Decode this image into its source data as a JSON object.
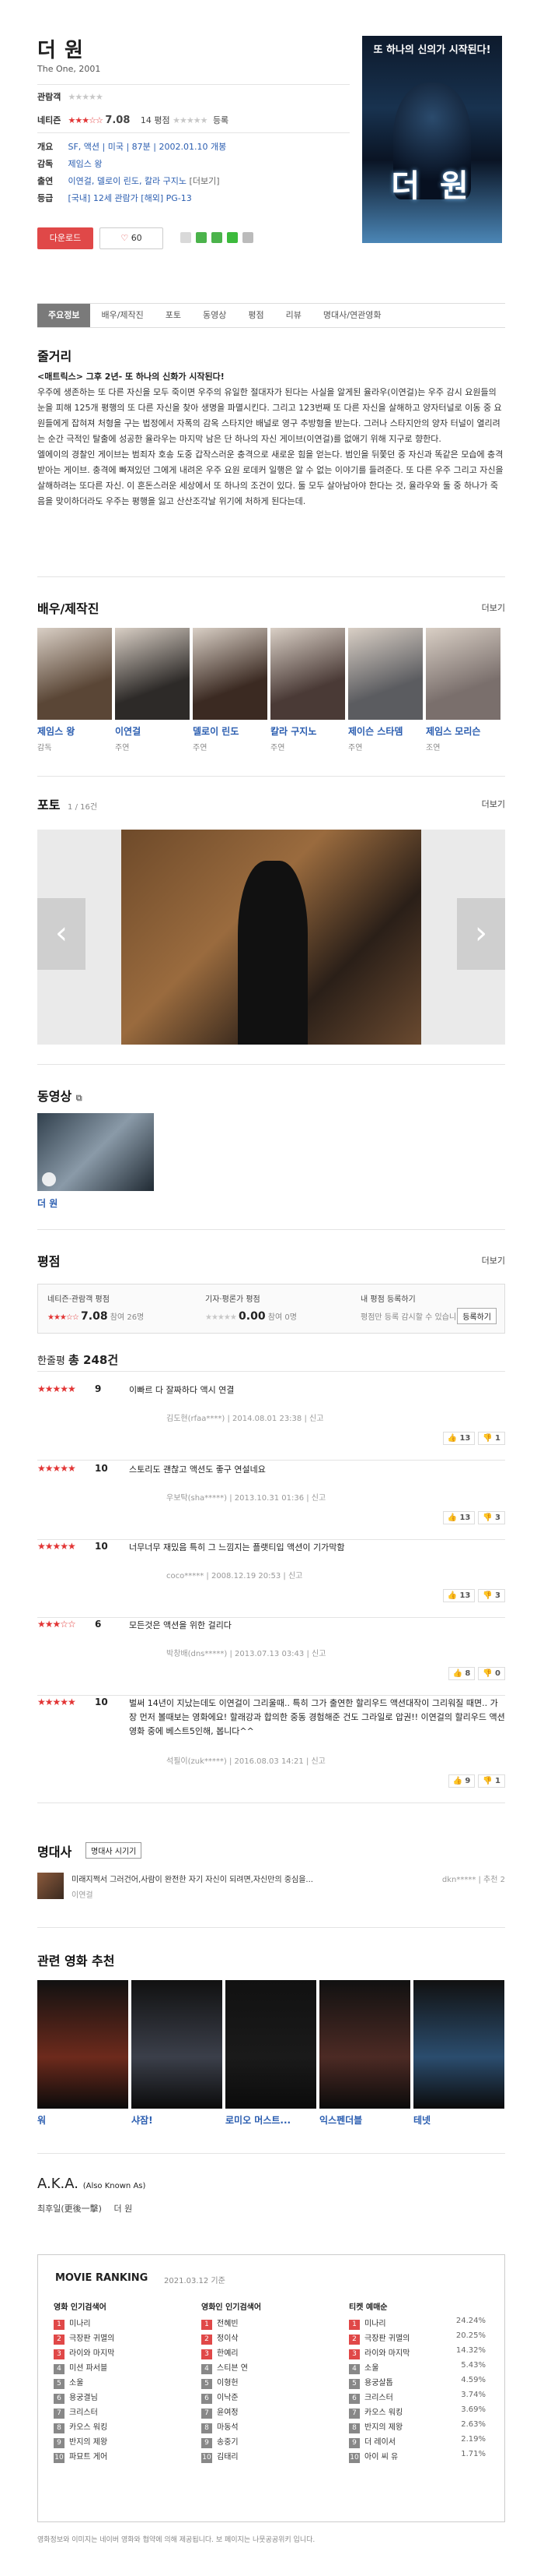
{
  "header": {
    "title": "더 원",
    "subtitle": "The One, 2001",
    "my_rating_label": "관람객",
    "netizen_label": "네티즌",
    "netizen_score": "7.08",
    "reviewer_prefix": "14 평점",
    "reviewer_more": "등록",
    "overview_label": "개요",
    "overview": "SF, 액션  |  미국  |  87분  |  2002.01.10 개봉",
    "director_label": "감독",
    "director": "제임스 왕",
    "cast_label": "출연",
    "cast": "이연걸, 델로이 린도, 칼라 구지노",
    "cast_more": "[더보기]",
    "grade_label": "등급",
    "grade": "[국내] 12세 관람가  [해외] PG-13",
    "download_label": "다운로드",
    "like_count": "60",
    "poster_caption": "또 하나의 신의가 시작된다!",
    "poster_title": "더 원"
  },
  "tabs": [
    "주요정보",
    "배우/제작진",
    "포토",
    "동영상",
    "평점",
    "리뷰",
    "명대사/연관영화"
  ],
  "synopsis": {
    "title": "줄거리",
    "headline": "<매트릭스> 그후 2년- 또 하나의 신화가 시작된다!",
    "body": "우주에 생존하는 또 다른 자신을 모두 죽이면 우주의 유일한 절대자가 된다는 사실을 알게된 율라우(이연걸)는 우주 감시 요원들의 눈을 피해 125개 평행의 또 다른 자신을 찾아 생명을 파멸시킨다. 그리고 123번째 또 다른 자신을 살해하고 양자터널로 이동 중 요원들에게 잡혀져 처형을 구는 법정에서 자폭의 감옥 스타지안 배널로 영구 추방형을 받는다. 그러나 스타지안의 양자 터널이 열리려는 순간 극적인 탈출에 성공한 율라우는 마지막 남은 단 하나의 자신 게이브(이연걸)를 없애기 위해 지구로 향한다.\n 엘에이의 경찰인 게이브는 범죄자 호송 도중 갑작스러운 충격으로 새로운 힘을 얻는다. 범인을 뒤쫓던 중 자신과 똑같은 모습에 충격 받아는 게이브. 충격에 빠져있던 그에게 내려온 우주 요원 로데커 일행은 알 수 없는 이야기를 들려준다. 또 다른 우주 그리고 자신을 살해하려는 또다른 자신. 이 혼돈스러운 세상에서 또 하나의 조건이 있다. 둘 모두 살아남아야 한다는 것, 율라우와 둘 중 하나가 죽음을 맞이하더라도 우주는 평행을 잃고 산산조각날 위기에 처하게 된다는데."
  },
  "cast_section": {
    "title": "배우/제작진",
    "more": "더보기",
    "people": [
      {
        "name": "제임스 왕",
        "role": "감독",
        "color": "#5a4636"
      },
      {
        "name": "이연걸",
        "role": "주연",
        "color": "#2d2a28"
      },
      {
        "name": "델로이 린도",
        "role": "주연",
        "color": "#3b2a22"
      },
      {
        "name": "칼라 구지노",
        "role": "주연",
        "color": "#4a3a36"
      },
      {
        "name": "제이슨 스타뎀",
        "role": "주연",
        "color": "#5b5c60"
      },
      {
        "name": "제임스 모리슨",
        "role": "조연",
        "color": "#7a6f6c"
      }
    ]
  },
  "photo_section": {
    "title": "포토",
    "counter": "1 / 16건",
    "more": "더보기"
  },
  "video_section": {
    "title": "동영상",
    "item_title": "더 원"
  },
  "rating_section": {
    "title": "평점",
    "more": "더보기",
    "netizen_label": "네티즌·관람객 평점",
    "netizen_score": "7.08",
    "netizen_count": "참여 26명",
    "critic_label": "기자·평론가 평점",
    "critic_score": "0.00",
    "critic_count": "참여 0명",
    "mine_label": "내 평점 등록하기",
    "mine_desc": "평점만 등록 감시할 수 있습니다.",
    "mine_button": "등록하기",
    "review_count_label": "한줄평",
    "review_count_value": "총 248건"
  },
  "reviews": [
    {
      "score": "9",
      "stars": 4.5,
      "text": "이빠르 다 잘짜하다 액시 연결",
      "meta": "김도현(rfaa****) | 2014.08.01 23:38 | 신고",
      "up": "13",
      "down": "1"
    },
    {
      "score": "10",
      "stars": 5,
      "text": "스토리도 괜찮고 액션도 좋구 연설네요",
      "meta": "우보탁(sha*****) | 2013.10.31 01:36 | 신고",
      "up": "13",
      "down": "3"
    },
    {
      "score": "10",
      "stars": 5,
      "text": "너무너무 재밌음 특히 그 느낌지는 플랫티입 액션이 기가막함",
      "meta": "coco***** | 2008.12.19 20:53 | 신고",
      "up": "13",
      "down": "3"
    },
    {
      "score": "6",
      "stars": 3,
      "text": "모든것은 액션을 위한 걸리다",
      "meta": "박창배(dns*****) | 2013.07.13 03:43 | 신고",
      "up": "8",
      "down": "0"
    },
    {
      "score": "10",
      "stars": 5,
      "text": "벌써 14년이 지났는데도 이연걸이 그리울때.. 특히 그가 출연한 할리우드 액션대작이 그리워질 때면.. 가장 먼저 볼때보는 영화에요! 할래강과 합의한 중동 경험해준 건도 그라일로 압권!! 이연걸의 할리우드 액션영화 중에 베스트5인해, 봅니다^^",
      "meta": "석필이(zuk*****) | 2016.08.03 14:21 | 신고",
      "up": "9",
      "down": "1"
    }
  ],
  "quotes": {
    "title": "명대사",
    "button": "명대사 시기기",
    "text": "미래지쩍서 그러건어,사람이 완전한 자기 자신이 되려면,자신만의 중심을...",
    "actor": "이연걸",
    "meta": "dkn***** | 추천 2"
  },
  "related": {
    "title": "관련 영화 추천",
    "items": [
      {
        "name": "워",
        "color": "#6d2a1c"
      },
      {
        "name": "샤잠!",
        "color": "#3b3f4a"
      },
      {
        "name": "로미오 머스트...",
        "color": "#1a1a1a"
      },
      {
        "name": "익스펜더블",
        "color": "#4c2a24"
      },
      {
        "name": "테넷",
        "color": "#2b4d6e"
      }
    ]
  },
  "aka": {
    "title": "A.K.A.",
    "title_small": "(Also Known As)",
    "label": "최후일(更後一擊)",
    "value": "더 원"
  },
  "ranking": {
    "title": "MOVIE RANKING",
    "date": "2021.03.12 기준",
    "columns": [
      {
        "heading": "영화 인기검색어",
        "rows": [
          "미나리",
          "극장판 귀멸의",
          "라이와 마지막",
          "미션 파서블",
          "소울",
          "용궁결님",
          "크리스터",
          "카오스 워킹",
          "반지의 제왕",
          "파묘트 게어"
        ]
      },
      {
        "heading": "영화인 인기검색어",
        "rows": [
          "전혜빈",
          "정이삭",
          "한예리",
          "스티븐 연",
          "이형헌",
          "이낙준",
          "윤여정",
          "마동석",
          "송중기",
          "김태리"
        ]
      },
      {
        "heading": "티켓 예매순",
        "rows": [
          "미나리",
          "극장판 귀멸의",
          "라이와 마지막",
          "소울",
          "용궁살톱",
          "크리스터",
          "카오스 워킹",
          "반지의 제왕",
          "더 레이서",
          "아이 씨 유"
        ],
        "rates": [
          "24.24%",
          "20.25%",
          "14.32%",
          "5.43%",
          "4.59%",
          "3.74%",
          "3.69%",
          "2.63%",
          "2.19%",
          "1.71%"
        ]
      }
    ]
  },
  "footnote": "영화정보와 이미지는 네이버 영화와 협약에 의해 제공됩니다. 보 페이지는 나뭇공공위키 입니다."
}
